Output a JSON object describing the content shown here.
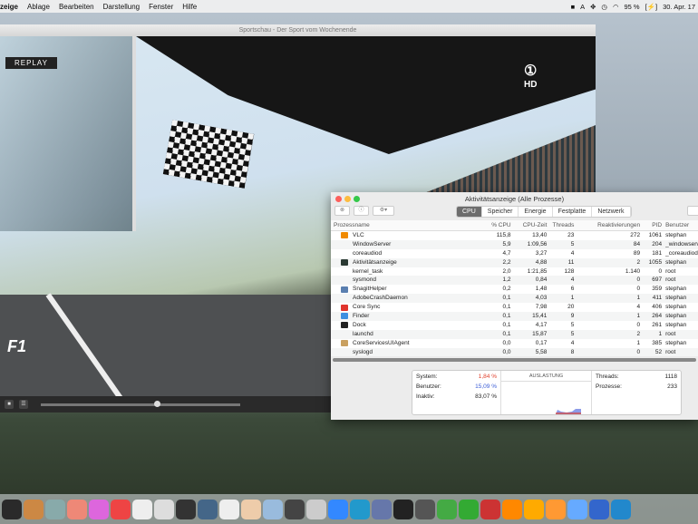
{
  "menubar": {
    "app": "zeige",
    "items": [
      "Ablage",
      "Bearbeiten",
      "Darstellung",
      "Fenster",
      "Hilfe"
    ],
    "battery": "95 %",
    "date": "30. Apr. 17"
  },
  "vlc": {
    "title": "Sportschau - Der Sport vom Wochenende",
    "replay": "REPLAY",
    "channel": "HD",
    "logo": "F1",
    "seek_progress": 0.57
  },
  "activity": {
    "title": "Aktivitätsanzeige (Alle Prozesse)",
    "tabs": [
      "CPU",
      "Speicher",
      "Energie",
      "Festplatte",
      "Netzwerk"
    ],
    "columns": [
      "Prozessname",
      "% CPU",
      "CPU-Zeit",
      "Threads",
      "Reaktivierungen",
      "PID",
      "Benutzer"
    ],
    "rows": [
      [
        "VLC",
        "115,8",
        "13,40",
        "23",
        "272",
        "1061",
        "stephan",
        "#f08a00"
      ],
      [
        "WindowServer",
        "5,9",
        "1:09,56",
        "5",
        "84",
        "204",
        "_windowserver",
        ""
      ],
      [
        "coreaudiod",
        "4,7",
        "3,27",
        "4",
        "89",
        "181",
        "_coreaudiod",
        ""
      ],
      [
        "Aktivitätsanzeige",
        "2,2",
        "4,88",
        "11",
        "2",
        "1055",
        "stephan",
        "#2b3a33"
      ],
      [
        "kernel_task",
        "2,0",
        "1:21,85",
        "128",
        "1.140",
        "0",
        "root",
        ""
      ],
      [
        "sysmond",
        "1,2",
        "0,84",
        "4",
        "0",
        "697",
        "root",
        ""
      ],
      [
        "SnagitHelper",
        "0,2",
        "1,48",
        "6",
        "0",
        "359",
        "stephan",
        "#5a7fb0"
      ],
      [
        "AdobeCrashDaemon",
        "0,1",
        "4,03",
        "1",
        "1",
        "411",
        "stephan",
        ""
      ],
      [
        "Core Sync",
        "0,1",
        "7,98",
        "20",
        "4",
        "406",
        "stephan",
        "#e0342c"
      ],
      [
        "Finder",
        "0,1",
        "15,41",
        "9",
        "1",
        "264",
        "stephan",
        "#3d8fe0"
      ],
      [
        "Dock",
        "0,1",
        "4,17",
        "5",
        "0",
        "261",
        "stephan",
        "#222"
      ],
      [
        "launchd",
        "0,1",
        "15,87",
        "5",
        "2",
        "1",
        "root",
        ""
      ],
      [
        "CoreServicesUIAgent",
        "0,0",
        "0,17",
        "4",
        "1",
        "385",
        "stephan",
        "#c9a060"
      ],
      [
        "syslogd",
        "0,0",
        "5,58",
        "8",
        "0",
        "52",
        "root",
        ""
      ]
    ],
    "stats": {
      "system_label": "System:",
      "system": "1,84 %",
      "user_label": "Benutzer:",
      "user": "15,09 %",
      "idle_label": "Inaktiv:",
      "idle": "83,07 %",
      "graph_title": "AUSLASTUNG",
      "threads_label": "Threads:",
      "threads": "1118",
      "processes_label": "Prozesse:",
      "processes": "233"
    },
    "colors": {
      "system": "#e0402c",
      "user": "#3a5cd6"
    }
  }
}
